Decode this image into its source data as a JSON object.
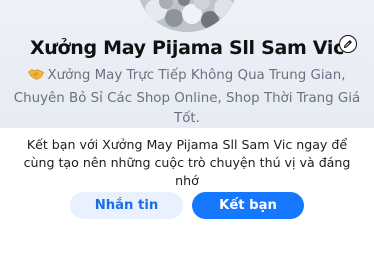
{
  "profile": {
    "name": "Xưởng May Pijama Sll Sam Vic",
    "bio_emoji": "🤝",
    "bio": "Xưởng May Trực Tiếp Không Qua Trung Gian, Chuyên Bỏ Sỉ Các Shop Online, Shop Thời Trang Giá Tốt."
  },
  "prompt": {
    "text": "Kết bạn với Xưởng May Pijama Sll Sam Vic ngay để cùng tạo nên những cuộc trò chuyện thú vị và đáng nhớ"
  },
  "actions": {
    "message_label": "Nhắn tin",
    "add_friend_label": "Kết bạn"
  },
  "icons": {
    "edit": "pencil-icon",
    "handshake": "handshake-emoji"
  },
  "colors": {
    "primary": "#1677ff",
    "secondary_bg": "#e8f1fd",
    "bio_text": "#6a7180"
  }
}
